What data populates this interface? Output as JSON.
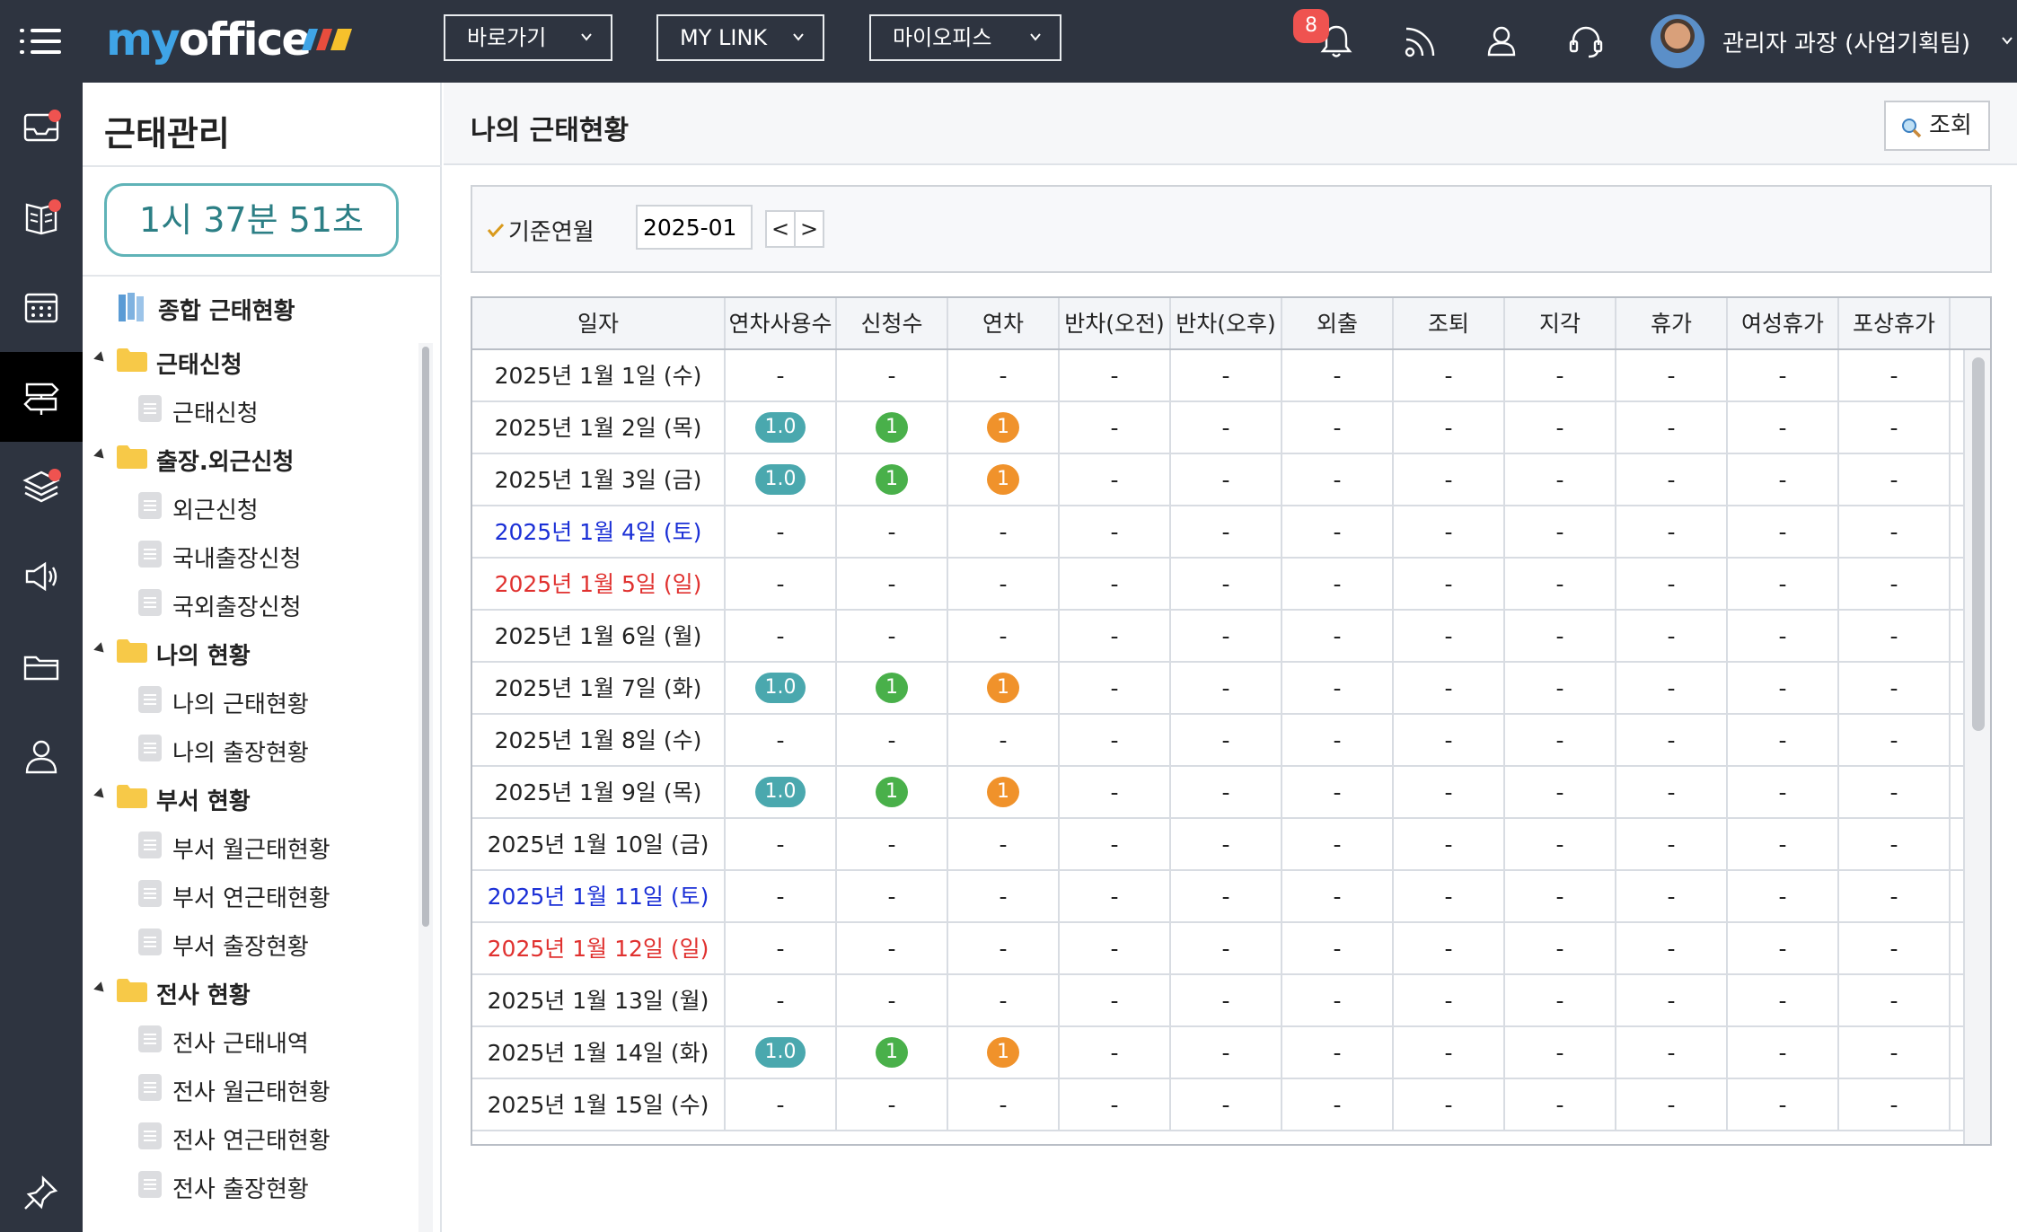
{
  "header": {
    "logo_my": "my",
    "logo_office": "office",
    "nav": [
      {
        "label": "바로가기"
      },
      {
        "label": "MY LINK"
      },
      {
        "label": "마이오피스"
      }
    ],
    "notification_count": "8",
    "user_name": "관리자 과장 (사업기획팀)"
  },
  "rail": {
    "items": [
      "inbox-icon",
      "board-icon",
      "calendar-icon",
      "signpost-icon",
      "layers-icon",
      "megaphone-icon",
      "folder-icon",
      "person-icon",
      "pin-icon"
    ],
    "active_index": 3,
    "dots": [
      0,
      1,
      4
    ]
  },
  "sidebar": {
    "title": "근태관리",
    "timer": "1시 37분 51초",
    "summary_label": "종합 근태현황",
    "tree": [
      {
        "type": "folder",
        "label": "근태신청"
      },
      {
        "type": "doc",
        "label": "근태신청"
      },
      {
        "type": "folder",
        "label": "출장.외근신청"
      },
      {
        "type": "doc",
        "label": "외근신청"
      },
      {
        "type": "doc",
        "label": "국내출장신청"
      },
      {
        "type": "doc",
        "label": "국외출장신청"
      },
      {
        "type": "folder",
        "label": "나의 현황"
      },
      {
        "type": "doc",
        "label": "나의 근태현황"
      },
      {
        "type": "doc",
        "label": "나의 출장현황"
      },
      {
        "type": "folder",
        "label": "부서 현황"
      },
      {
        "type": "doc",
        "label": "부서 월근태현황"
      },
      {
        "type": "doc",
        "label": "부서 연근태현황"
      },
      {
        "type": "doc",
        "label": "부서 출장현황"
      },
      {
        "type": "folder",
        "label": "전사 현황"
      },
      {
        "type": "doc",
        "label": "전사 근태내역"
      },
      {
        "type": "doc",
        "label": "전사 월근태현황"
      },
      {
        "type": "doc",
        "label": "전사 연근태현황"
      },
      {
        "type": "doc",
        "label": "전사 출장현황"
      }
    ]
  },
  "main": {
    "title": "나의 근태현황",
    "search_label": "조회",
    "filter": {
      "label": "기준연월",
      "value": "2025-01",
      "prev": "<",
      "next": ">"
    },
    "columns": [
      "일자",
      "연차사용수",
      "신청수",
      "연차",
      "반차(오전)",
      "반차(오후)",
      "외출",
      "조퇴",
      "지각",
      "휴가",
      "여성휴가",
      "포상휴가"
    ],
    "rows": [
      {
        "date": "2025년 1월 1일 (수)",
        "day": "weekday",
        "used": "-",
        "requests": "-",
        "annual": "-"
      },
      {
        "date": "2025년 1월 2일 (목)",
        "day": "weekday",
        "used": "1.0",
        "requests": "1",
        "annual": "1"
      },
      {
        "date": "2025년 1월 3일 (금)",
        "day": "weekday",
        "used": "1.0",
        "requests": "1",
        "annual": "1"
      },
      {
        "date": "2025년 1월 4일 (토)",
        "day": "sat",
        "used": "-",
        "requests": "-",
        "annual": "-"
      },
      {
        "date": "2025년 1월 5일 (일)",
        "day": "sun",
        "used": "-",
        "requests": "-",
        "annual": "-"
      },
      {
        "date": "2025년 1월 6일 (월)",
        "day": "weekday",
        "used": "-",
        "requests": "-",
        "annual": "-"
      },
      {
        "date": "2025년 1월 7일 (화)",
        "day": "weekday",
        "used": "1.0",
        "requests": "1",
        "annual": "1"
      },
      {
        "date": "2025년 1월 8일 (수)",
        "day": "weekday",
        "used": "-",
        "requests": "-",
        "annual": "-"
      },
      {
        "date": "2025년 1월 9일 (목)",
        "day": "weekday",
        "used": "1.0",
        "requests": "1",
        "annual": "1"
      },
      {
        "date": "2025년 1월 10일 (금)",
        "day": "weekday",
        "used": "-",
        "requests": "-",
        "annual": "-"
      },
      {
        "date": "2025년 1월 11일 (토)",
        "day": "sat",
        "used": "-",
        "requests": "-",
        "annual": "-"
      },
      {
        "date": "2025년 1월 12일 (일)",
        "day": "sun",
        "used": "-",
        "requests": "-",
        "annual": "-"
      },
      {
        "date": "2025년 1월 13일 (월)",
        "day": "weekday",
        "used": "-",
        "requests": "-",
        "annual": "-"
      },
      {
        "date": "2025년 1월 14일 (화)",
        "day": "weekday",
        "used": "1.0",
        "requests": "1",
        "annual": "1"
      },
      {
        "date": "2025년 1월 15일 (수)",
        "day": "weekday",
        "used": "-",
        "requests": "-",
        "annual": "-"
      }
    ],
    "empty_value": "-"
  },
  "colors": {
    "header_bg": "#2e3440",
    "logo_blue": "#3fa4e6",
    "timer_border": "#5fb3b7",
    "pill_teal": "#4aa8ae",
    "pill_green": "#49b04a",
    "pill_orange": "#f0922b",
    "saturday": "#1a2fd6",
    "sunday": "#e0312f",
    "badge_red": "#ef5350"
  }
}
